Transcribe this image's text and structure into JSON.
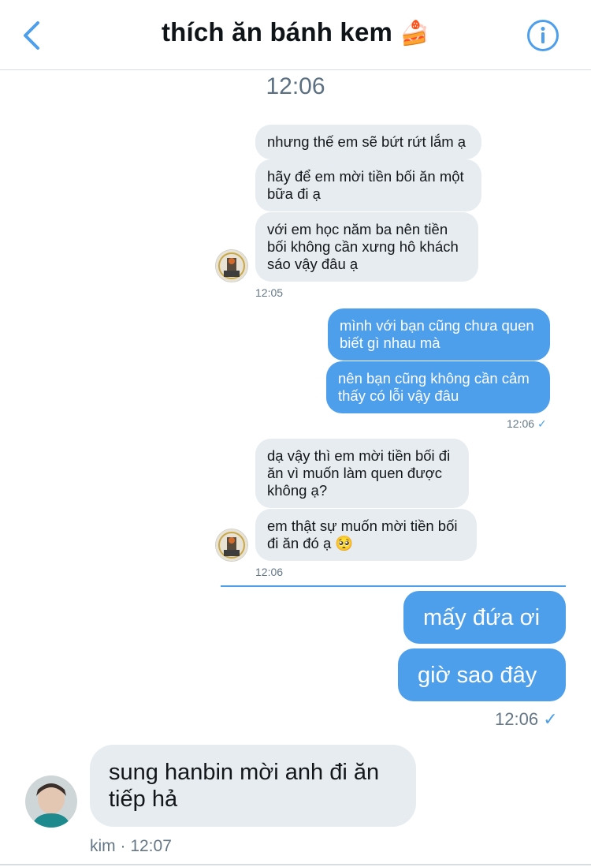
{
  "header": {
    "title": "thích ăn bánh kem",
    "title_emoji": "🍰",
    "back_icon": "chevron-left-icon",
    "info_icon": "info-circle-icon"
  },
  "conversation": {
    "top_timestamp": "12:06",
    "messages": [
      {
        "side": "in",
        "text": "nhưng thế em sẽ bứt rứt lắm ạ"
      },
      {
        "side": "in",
        "text": "hãy để em mời tiền bối ăn một bữa đi ạ"
      },
      {
        "side": "in",
        "text": "với em học năm ba nên tiền bối không cần xưng hô khách sáo vậy đâu ạ"
      },
      {
        "side": "out",
        "text": "mình với bạn cũng chưa quen biết gì nhau mà"
      },
      {
        "side": "out",
        "text": "nên bạn cũng không cần cảm thấy có lỗi vậy đâu"
      },
      {
        "side": "in",
        "text": "dạ vậy thì em mời tiền bối đi ăn vì muốn làm quen được không ạ?"
      },
      {
        "side": "in",
        "text": "em thật sự muốn mời tiền bối đi ăn đó ạ",
        "emoji": "🥺"
      },
      {
        "side": "out",
        "text": "mấy đứa ơi"
      },
      {
        "side": "out",
        "text": "giờ sao đây"
      },
      {
        "side": "in",
        "text": "sung hanbin mời anh đi ăn tiếp hả"
      }
    ],
    "group_times": [
      "12:05",
      "12:06",
      "12:06",
      "12:06"
    ],
    "check_mark": "✓",
    "last_sender": "kim",
    "last_time": "kim · 12:07"
  },
  "colors": {
    "accent": "#4d9fec",
    "incoming_bubble": "#e6ecf0",
    "outgoing_bubble": "#4d9fec"
  }
}
